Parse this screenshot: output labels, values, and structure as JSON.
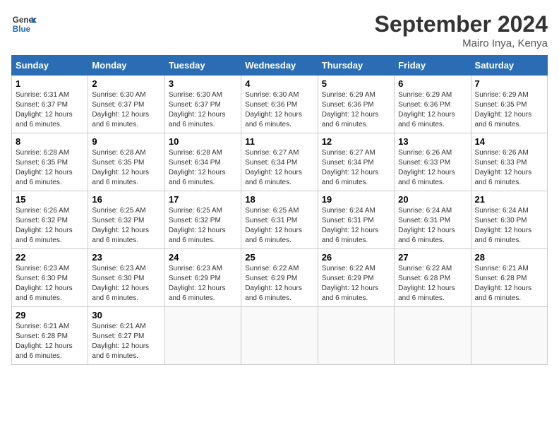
{
  "header": {
    "logo_line1": "General",
    "logo_line2": "Blue",
    "month_title": "September 2024",
    "location": "Mairo Inya, Kenya"
  },
  "days_of_week": [
    "Sunday",
    "Monday",
    "Tuesday",
    "Wednesday",
    "Thursday",
    "Friday",
    "Saturday"
  ],
  "weeks": [
    [
      {
        "day": "1",
        "rise": "6:31 AM",
        "set": "6:37 PM",
        "daylight": "12 hours and 6 minutes."
      },
      {
        "day": "2",
        "rise": "6:30 AM",
        "set": "6:37 PM",
        "daylight": "12 hours and 6 minutes."
      },
      {
        "day": "3",
        "rise": "6:30 AM",
        "set": "6:37 PM",
        "daylight": "12 hours and 6 minutes."
      },
      {
        "day": "4",
        "rise": "6:30 AM",
        "set": "6:36 PM",
        "daylight": "12 hours and 6 minutes."
      },
      {
        "day": "5",
        "rise": "6:29 AM",
        "set": "6:36 PM",
        "daylight": "12 hours and 6 minutes."
      },
      {
        "day": "6",
        "rise": "6:29 AM",
        "set": "6:36 PM",
        "daylight": "12 hours and 6 minutes."
      },
      {
        "day": "7",
        "rise": "6:29 AM",
        "set": "6:35 PM",
        "daylight": "12 hours and 6 minutes."
      }
    ],
    [
      {
        "day": "8",
        "rise": "6:28 AM",
        "set": "6:35 PM",
        "daylight": "12 hours and 6 minutes."
      },
      {
        "day": "9",
        "rise": "6:28 AM",
        "set": "6:35 PM",
        "daylight": "12 hours and 6 minutes."
      },
      {
        "day": "10",
        "rise": "6:28 AM",
        "set": "6:34 PM",
        "daylight": "12 hours and 6 minutes."
      },
      {
        "day": "11",
        "rise": "6:27 AM",
        "set": "6:34 PM",
        "daylight": "12 hours and 6 minutes."
      },
      {
        "day": "12",
        "rise": "6:27 AM",
        "set": "6:34 PM",
        "daylight": "12 hours and 6 minutes."
      },
      {
        "day": "13",
        "rise": "6:26 AM",
        "set": "6:33 PM",
        "daylight": "12 hours and 6 minutes."
      },
      {
        "day": "14",
        "rise": "6:26 AM",
        "set": "6:33 PM",
        "daylight": "12 hours and 6 minutes."
      }
    ],
    [
      {
        "day": "15",
        "rise": "6:26 AM",
        "set": "6:32 PM",
        "daylight": "12 hours and 6 minutes."
      },
      {
        "day": "16",
        "rise": "6:25 AM",
        "set": "6:32 PM",
        "daylight": "12 hours and 6 minutes."
      },
      {
        "day": "17",
        "rise": "6:25 AM",
        "set": "6:32 PM",
        "daylight": "12 hours and 6 minutes."
      },
      {
        "day": "18",
        "rise": "6:25 AM",
        "set": "6:31 PM",
        "daylight": "12 hours and 6 minutes."
      },
      {
        "day": "19",
        "rise": "6:24 AM",
        "set": "6:31 PM",
        "daylight": "12 hours and 6 minutes."
      },
      {
        "day": "20",
        "rise": "6:24 AM",
        "set": "6:31 PM",
        "daylight": "12 hours and 6 minutes."
      },
      {
        "day": "21",
        "rise": "6:24 AM",
        "set": "6:30 PM",
        "daylight": "12 hours and 6 minutes."
      }
    ],
    [
      {
        "day": "22",
        "rise": "6:23 AM",
        "set": "6:30 PM",
        "daylight": "12 hours and 6 minutes."
      },
      {
        "day": "23",
        "rise": "6:23 AM",
        "set": "6:30 PM",
        "daylight": "12 hours and 6 minutes."
      },
      {
        "day": "24",
        "rise": "6:23 AM",
        "set": "6:29 PM",
        "daylight": "12 hours and 6 minutes."
      },
      {
        "day": "25",
        "rise": "6:22 AM",
        "set": "6:29 PM",
        "daylight": "12 hours and 6 minutes."
      },
      {
        "day": "26",
        "rise": "6:22 AM",
        "set": "6:29 PM",
        "daylight": "12 hours and 6 minutes."
      },
      {
        "day": "27",
        "rise": "6:22 AM",
        "set": "6:28 PM",
        "daylight": "12 hours and 6 minutes."
      },
      {
        "day": "28",
        "rise": "6:21 AM",
        "set": "6:28 PM",
        "daylight": "12 hours and 6 minutes."
      }
    ],
    [
      {
        "day": "29",
        "rise": "6:21 AM",
        "set": "6:28 PM",
        "daylight": "12 hours and 6 minutes."
      },
      {
        "day": "30",
        "rise": "6:21 AM",
        "set": "6:27 PM",
        "daylight": "12 hours and 6 minutes."
      },
      null,
      null,
      null,
      null,
      null
    ]
  ]
}
